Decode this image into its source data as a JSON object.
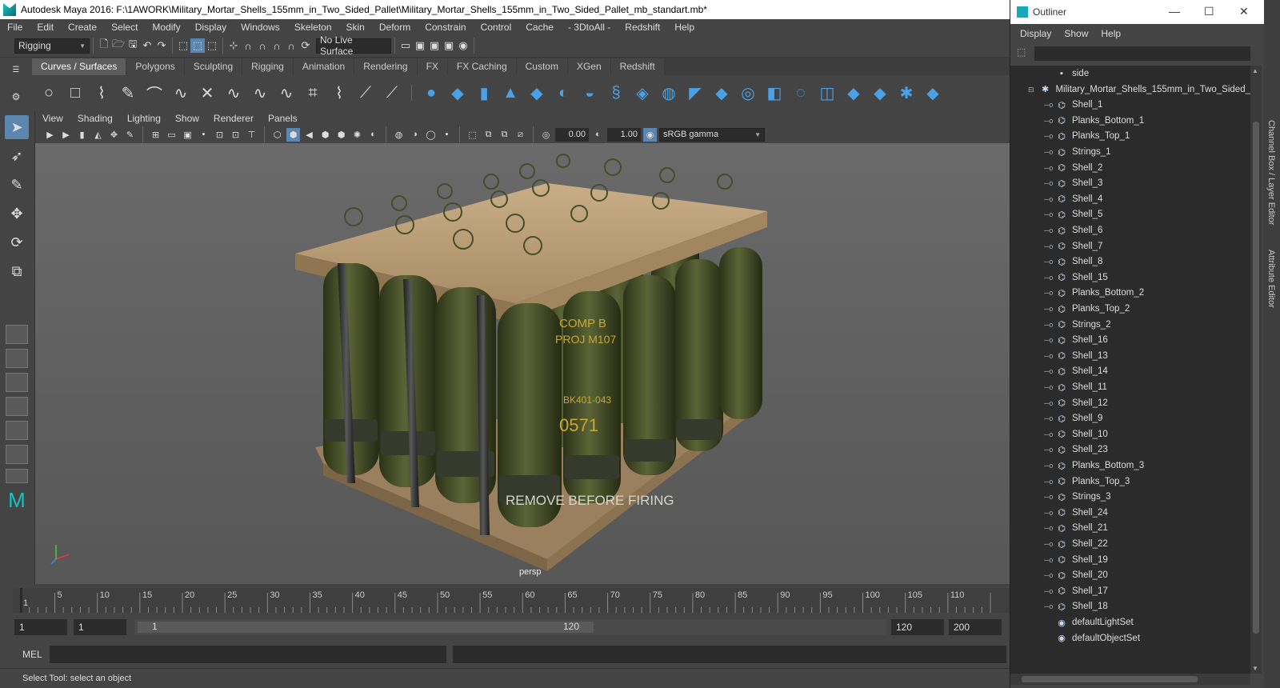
{
  "window_title": "Autodesk Maya 2016: F:\\1AWORK\\Military_Mortar_Shells_155mm_in_Two_Sided_Pallet\\Military_Mortar_Shells_155mm_in_Two_Sided_Pallet_mb_standart.mb*",
  "menu": [
    "File",
    "Edit",
    "Create",
    "Select",
    "Modify",
    "Display",
    "Windows",
    "Skeleton",
    "Skin",
    "Deform",
    "Constrain",
    "Control",
    "Cache",
    "- 3DtoAll -",
    "Redshift",
    "Help"
  ],
  "status_line": {
    "mode": "Rigging",
    "live_surface": "No Live Surface"
  },
  "shelf_tabs": [
    "Curves / Surfaces",
    "Polygons",
    "Sculpting",
    "Rigging",
    "Animation",
    "Rendering",
    "FX",
    "FX Caching",
    "Custom",
    "XGen",
    "Redshift"
  ],
  "active_shelf_tab": "Curves / Surfaces",
  "viewport_menu": [
    "View",
    "Shading",
    "Lighting",
    "Show",
    "Renderer",
    "Panels"
  ],
  "viewport_toolbar": {
    "exposure": "0.00",
    "gamma": "1.00",
    "color_space": "sRGB gamma"
  },
  "viewport_label": "persp",
  "timeline_ticks": [
    "5",
    "10",
    "15",
    "20",
    "25",
    "30",
    "35",
    "40",
    "45",
    "50",
    "55",
    "60",
    "65",
    "70",
    "75",
    "80",
    "85",
    "90",
    "95",
    "100",
    "105",
    "110",
    "1"
  ],
  "range": {
    "start": "1",
    "current": "1",
    "slider_start": "1",
    "slider_end": "120",
    "end": "120",
    "max": "200"
  },
  "command_line_label": "MEL",
  "help_line": "Select Tool: select an object",
  "outliner": {
    "title": "Outliner",
    "menu": [
      "Display",
      "Show",
      "Help"
    ],
    "camera_item": "side",
    "root": "Military_Mortar_Shells_155mm_in_Two_Sided_",
    "children": [
      "Shell_1",
      "Planks_Bottom_1",
      "Planks_Top_1",
      "Strings_1",
      "Shell_2",
      "Shell_3",
      "Shell_4",
      "Shell_5",
      "Shell_6",
      "Shell_7",
      "Shell_8",
      "Shell_15",
      "Planks_Bottom_2",
      "Planks_Top_2",
      "Strings_2",
      "Shell_16",
      "Shell_13",
      "Shell_14",
      "Shell_11",
      "Shell_12",
      "Shell_9",
      "Shell_10",
      "Shell_23",
      "Planks_Bottom_3",
      "Planks_Top_3",
      "Strings_3",
      "Shell_24",
      "Shell_21",
      "Shell_22",
      "Shell_19",
      "Shell_20",
      "Shell_17",
      "Shell_18"
    ],
    "sets": [
      "defaultLightSet",
      "defaultObjectSet"
    ]
  },
  "side_tabs": [
    "Channel Box / Layer Editor",
    "Attribute Editor"
  ],
  "shell_labels": {
    "a": "COMP B",
    "b": "PROJ M107",
    "c": "BK401-043",
    "d": "0571",
    "e": "REMOVE BEFORE FIRING"
  }
}
